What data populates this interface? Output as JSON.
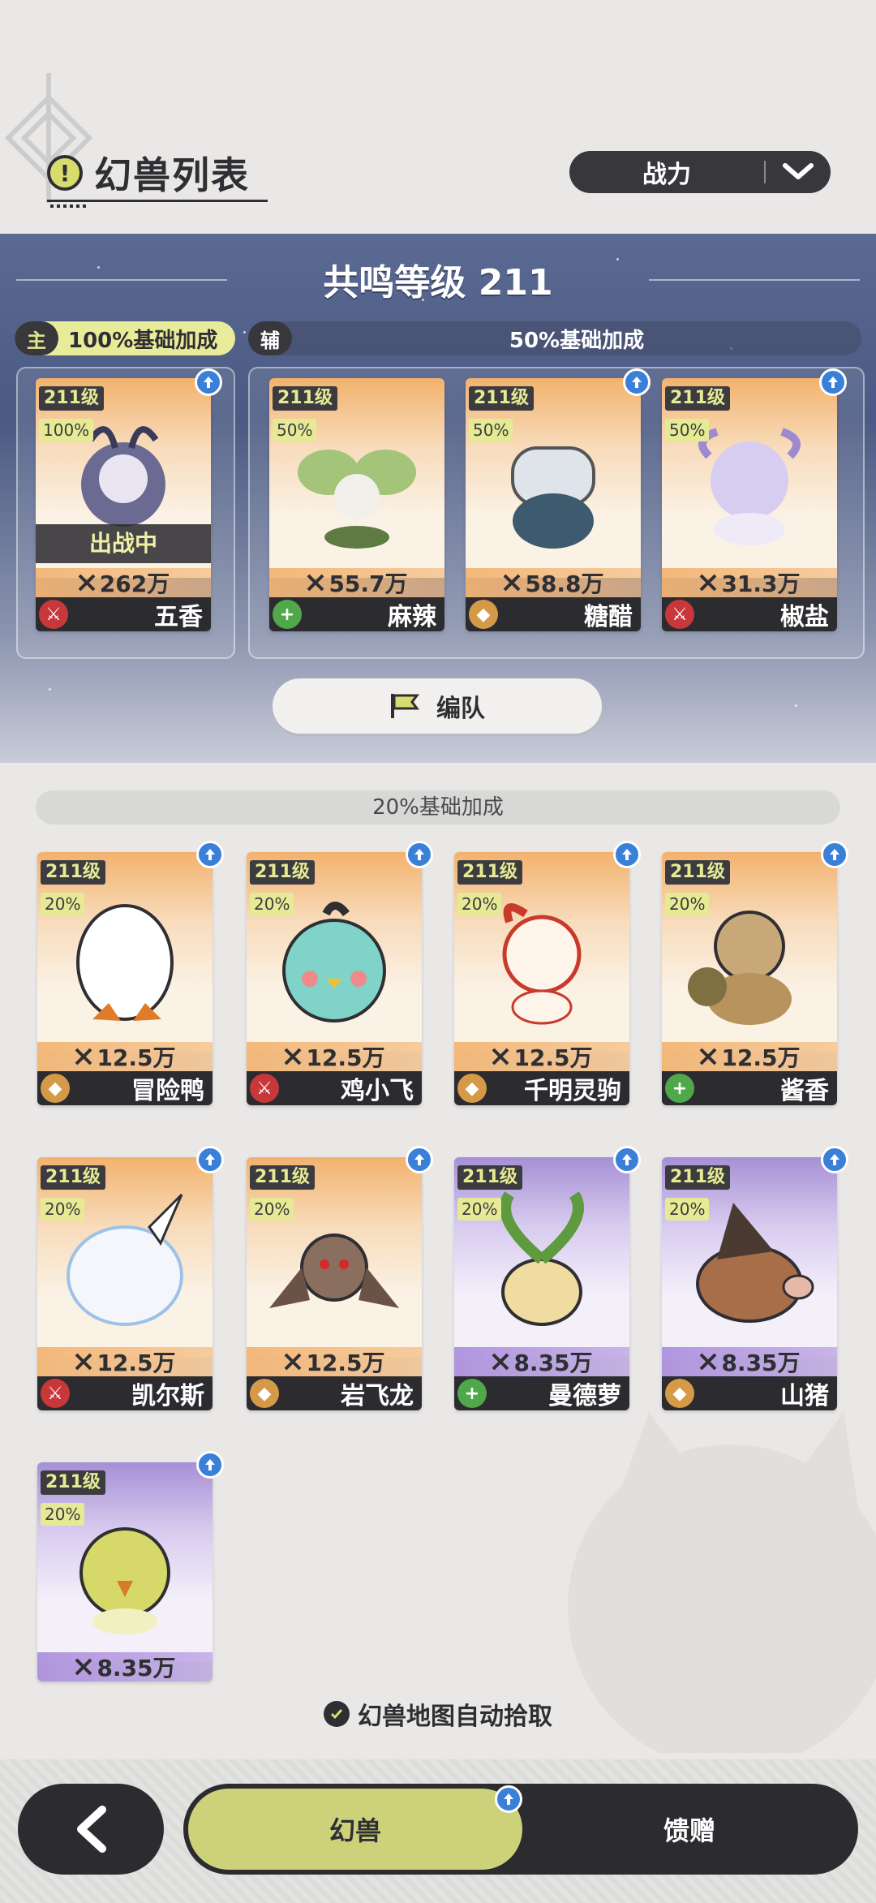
{
  "header": {
    "title": "幻兽列表",
    "sort": {
      "label": "战力"
    }
  },
  "resonance": {
    "title": "共鸣等级 211",
    "main_badge": "主",
    "main_bonus": "100%基础加成",
    "sub_badge": "辅",
    "sub_bonus": "50%基础加成",
    "team_button": "编队"
  },
  "main_pet": {
    "level": "211级",
    "percent": "100%",
    "status": "出战中",
    "power": "262万",
    "name": "五香",
    "role": "attack",
    "theme": "orange",
    "upgrade": true
  },
  "sub_pets": [
    {
      "level": "211级",
      "percent": "50%",
      "power": "55.7万",
      "name": "麻辣",
      "role": "heal",
      "theme": "orange",
      "upgrade": false
    },
    {
      "level": "211级",
      "percent": "50%",
      "power": "58.8万",
      "name": "糖醋",
      "role": "defense",
      "theme": "orange",
      "upgrade": true
    },
    {
      "level": "211级",
      "percent": "50%",
      "power": "31.3万",
      "name": "椒盐",
      "role": "attack",
      "theme": "orange",
      "upgrade": true
    }
  ],
  "reserve": {
    "bonus": "20%基础加成",
    "pets": [
      {
        "level": "211级",
        "percent": "20%",
        "power": "12.5万",
        "name": "冒险鸭",
        "role": "defense",
        "theme": "orange"
      },
      {
        "level": "211级",
        "percent": "20%",
        "power": "12.5万",
        "name": "鸡小飞",
        "role": "attack",
        "theme": "orange"
      },
      {
        "level": "211级",
        "percent": "20%",
        "power": "12.5万",
        "name": "千明灵驹",
        "role": "defense",
        "theme": "orange"
      },
      {
        "level": "211级",
        "percent": "20%",
        "power": "12.5万",
        "name": "酱香",
        "role": "heal",
        "theme": "orange"
      },
      {
        "level": "211级",
        "percent": "20%",
        "power": "12.5万",
        "name": "凯尔斯",
        "role": "attack",
        "theme": "orange"
      },
      {
        "level": "211级",
        "percent": "20%",
        "power": "12.5万",
        "name": "岩飞龙",
        "role": "defense",
        "theme": "orange"
      },
      {
        "level": "211级",
        "percent": "20%",
        "power": "8.35万",
        "name": "曼德萝",
        "role": "heal",
        "theme": "purple"
      },
      {
        "level": "211级",
        "percent": "20%",
        "power": "8.35万",
        "name": "山猪",
        "role": "defense",
        "theme": "purple"
      },
      {
        "level": "211级",
        "percent": "20%",
        "power": "8.35万",
        "name": "",
        "role": "",
        "theme": "purple"
      }
    ]
  },
  "auto_pickup": "幻兽地图自动拾取",
  "bottom_nav": {
    "back_icon": "back-arrow-icon",
    "tab_pets": "幻兽",
    "tab_gift": "馈赠"
  }
}
